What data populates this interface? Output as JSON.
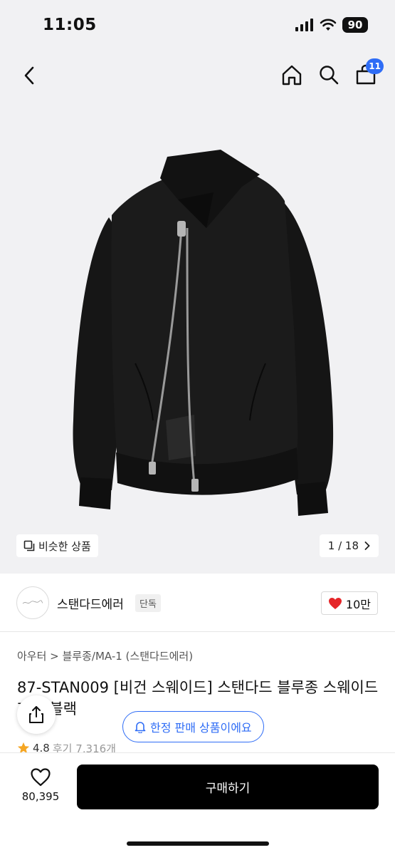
{
  "status_bar": {
    "time": "11:05",
    "battery": "90"
  },
  "nav": {
    "cart_count": "11"
  },
  "gallery": {
    "similar_label": "비슷한 상품",
    "page_indicator": "1 / 18"
  },
  "brand": {
    "name": "스탠다드에러",
    "tag": "단독",
    "likes": "10만"
  },
  "product": {
    "category": "아우터 > 블루종/MA-1 (스탠다드에러)",
    "title": "87-STAN009 [비건 스웨이드] 스탠다드 블루종 스웨이드 자켓 블랙",
    "rating": "4.8",
    "reviews": "후기 7,316개"
  },
  "limited_banner": "한정 판매 상품이에요",
  "bottom": {
    "wish_count": "80,395",
    "buy_label": "구매하기"
  },
  "colors": {
    "accent": "#2f6df6",
    "heart": "#e52528",
    "background": "#f1f1f3"
  }
}
